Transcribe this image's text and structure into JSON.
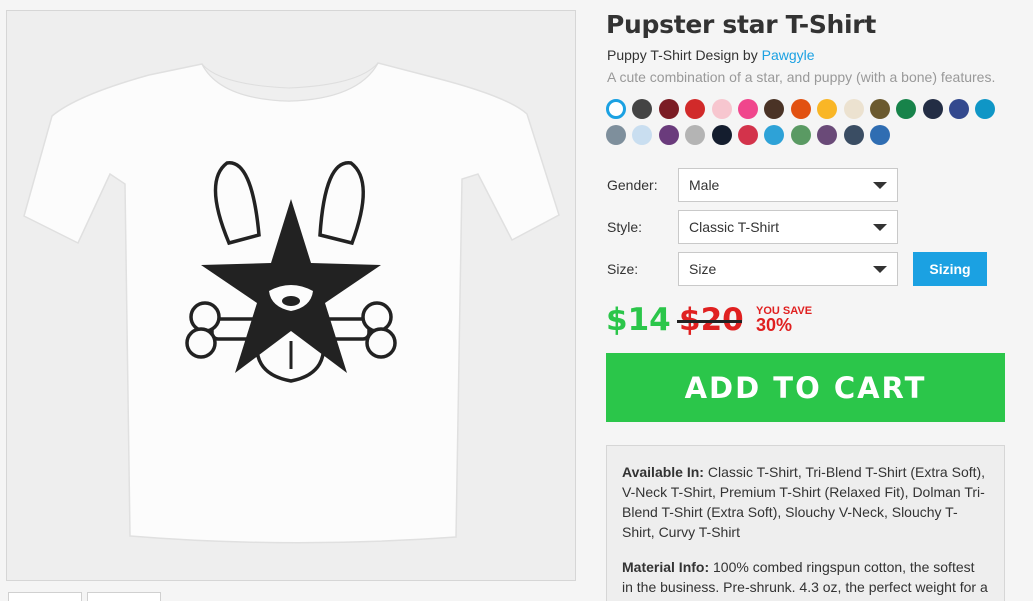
{
  "product": {
    "title": "Pupster star T-Shirt",
    "byline_prefix": "Puppy T-Shirt Design by ",
    "artist": "Pawgyle",
    "description": "A cute combination of a star, and puppy (with a bone) features."
  },
  "swatches": {
    "row1": [
      "#ffffff",
      "#444444",
      "#7b1c24",
      "#d12a2a",
      "#f7c6cf",
      "#f0468c",
      "#4a3326",
      "#e25111",
      "#f9b626",
      "#ece2d0",
      "#6b5a2f",
      "#17834a",
      "#232d44",
      "#33498e",
      "#0f96c6"
    ],
    "row2": [
      "#7e8f9c",
      "#c9def0",
      "#6a3b7c",
      "#b4b4b4",
      "#141d2e",
      "#d3334b",
      "#2ea2d7",
      "#5a9a63",
      "#6a4a78",
      "#3a4d63",
      "#2f6db2"
    ],
    "selected_index": 0,
    "selected_ring_color": "#1ba1e2"
  },
  "options": {
    "gender_label": "Gender:",
    "gender_value": "Male",
    "style_label": "Style:",
    "style_value": "Classic T-Shirt",
    "size_label": "Size:",
    "size_value": "Size",
    "sizing_button": "Sizing"
  },
  "price": {
    "current": "$14",
    "original": "$20",
    "you_save_label": "YOU SAVE",
    "you_save_percent": "30%"
  },
  "cart": {
    "button_label": "ADD TO CART"
  },
  "info": {
    "available_label": "Available In:",
    "available_text": " Classic T-Shirt, Tri-Blend T-Shirt (Extra Soft), V-Neck T-Shirt, Premium T-Shirt (Relaxed Fit), Dolman Tri-Blend T-Shirt (Extra Soft), Slouchy V-Neck, Slouchy T-Shirt, Curvy T-Shirt",
    "material_label": "Material Info:",
    "material_text": " 100% combed ringspun cotton, the softest in the business. Pre-shrunk. 4.3 oz, the perfect weight for a"
  },
  "colors": {
    "accent": "#1ba1e2",
    "price_green": "#2bc64a",
    "sale_red": "#e02020"
  }
}
